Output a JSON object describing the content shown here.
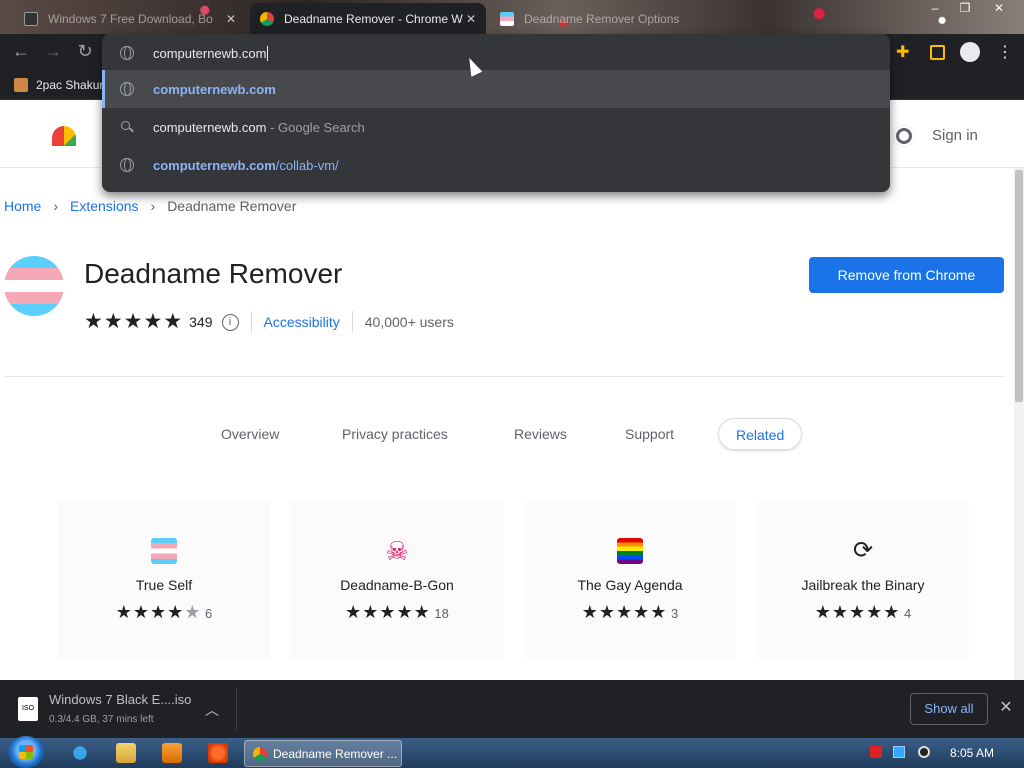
{
  "tabs": [
    {
      "title": "Windows 7 Free Download, Bo",
      "close": "✕"
    },
    {
      "title": "Deadname Remover - Chrome W",
      "close": "✕"
    },
    {
      "title": "Deadname Remover Options",
      "close": ""
    }
  ],
  "window_controls": {
    "minimize": "–",
    "maximize": "❐",
    "close": "✕"
  },
  "bookmarks": [
    {
      "label": "2pac Shakur"
    }
  ],
  "omnibox": {
    "input_value": "computernewb.com",
    "suggestions": [
      {
        "bold": "computernewb.com",
        "rest": "",
        "kind": "url"
      },
      {
        "text": "computernewb.com",
        "suffix": " - Google Search",
        "kind": "search"
      },
      {
        "bold": "computernewb.com",
        "rest": "/collab-vm/",
        "kind": "url"
      }
    ]
  },
  "header": {
    "signin": "Sign in"
  },
  "breadcrumb": {
    "home": "Home",
    "extensions": "Extensions",
    "current": "Deadname Remover",
    "sep": "›"
  },
  "extension": {
    "name": "Deadname Remover",
    "rating_count": "349",
    "rating": 4.5,
    "info": "i",
    "category": "Accessibility",
    "users": "40,000+ users",
    "action": "Remove from Chrome"
  },
  "page_tabs": [
    {
      "label": "Overview"
    },
    {
      "label": "Privacy practices"
    },
    {
      "label": "Reviews"
    },
    {
      "label": "Support"
    },
    {
      "label": "Related"
    }
  ],
  "related": [
    {
      "name": "True Self",
      "stars": 4,
      "count": "6",
      "icon": "trans-flag-icon"
    },
    {
      "name": "Deadname-B-Gon",
      "stars": 5,
      "count": "18",
      "icon": "skull-icon"
    },
    {
      "name": "The Gay Agenda",
      "stars": 5,
      "count": "3",
      "icon": "rainbow-book-icon"
    },
    {
      "name": "Jailbreak the Binary",
      "stars": 5,
      "count": "4",
      "icon": "cycle-icon"
    }
  ],
  "download": {
    "file": "Windows 7 Black E....iso",
    "status": "0.3/4.4 GB, 37 mins left",
    "icon_label": "ISO",
    "show_all": "Show all"
  },
  "taskbar": {
    "active_app": "Deadname Remover ...",
    "clock": "8:05 AM"
  },
  "colors": {
    "accent": "#1a73e8",
    "dark": "#202124"
  }
}
